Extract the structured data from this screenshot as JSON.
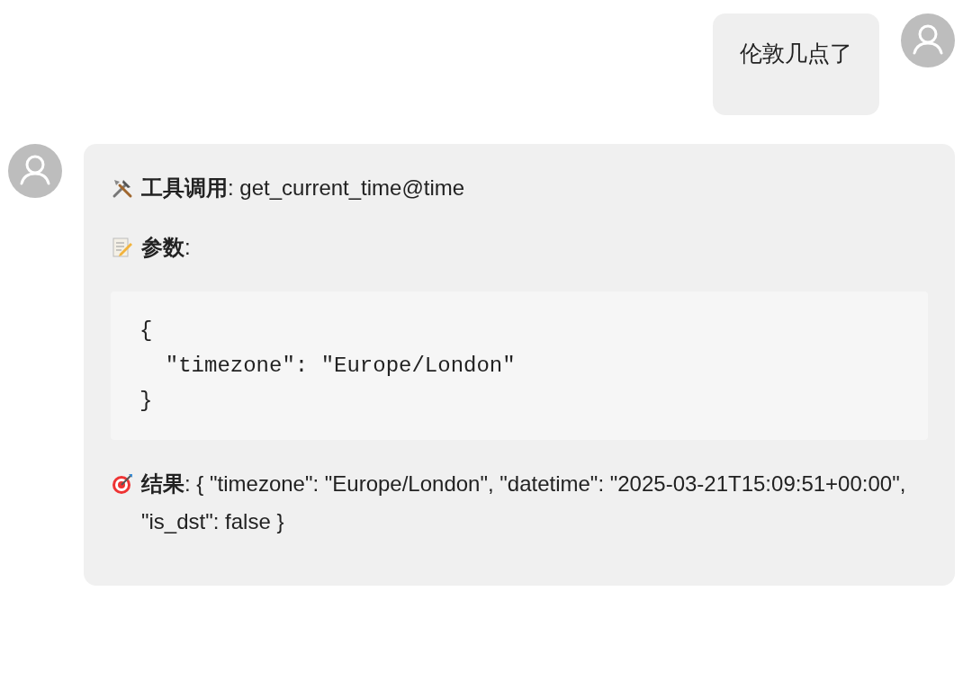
{
  "messages": [
    {
      "kind": "user",
      "text": "伦敦几点了"
    },
    {
      "kind": "assistant",
      "blocks": [
        {
          "kind": "tool",
          "text": "**工具调用**: get_current_time@time"
        },
        {
          "kind": "params",
          "text": "**参数**:"
        },
        {
          "kind": "code",
          "lines": [
            "{",
            "  \"timezone\": \"Europe/London\"",
            "}"
          ]
        },
        {
          "kind": "result",
          "text": "**结果**: { \"timezone\": \"Europe/London\", \"datetime\": \"2025-03-21T15:09:51+00:00\", \"is_dst\": false }"
        }
      ]
    }
  ]
}
